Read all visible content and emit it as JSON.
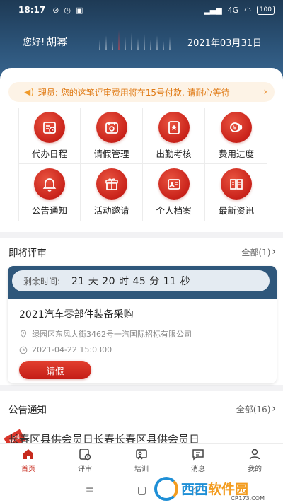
{
  "status_bar": {
    "time": "18:17",
    "battery": "100",
    "signal": "4G"
  },
  "header": {
    "greeting": "您好!",
    "user_name": "胡幂",
    "date": "2021年03月31日"
  },
  "notice": {
    "text": "理员: 您的这笔评审费用将在15号付款, 请耐心等待"
  },
  "quick_menu": [
    {
      "label": "代办日程",
      "icon": "schedule-icon"
    },
    {
      "label": "请假管理",
      "icon": "leave-calendar-icon"
    },
    {
      "label": "出勤考核",
      "icon": "attendance-icon"
    },
    {
      "label": "费用进度",
      "icon": "coins-icon"
    },
    {
      "label": "公告通知",
      "icon": "bell-icon"
    },
    {
      "label": "活动邀请",
      "icon": "gift-icon"
    },
    {
      "label": "个人档案",
      "icon": "profile-card-icon"
    },
    {
      "label": "最新资讯",
      "icon": "news-icon"
    }
  ],
  "upcoming": {
    "title": "即将评审",
    "more": "全部(1)",
    "card": {
      "countdown_label": "剩余时间:",
      "countdown_value": "21 天 20 时 45 分 11 秒",
      "title": "2021汽车零部件装备采购",
      "location": "绿园区东风大街3462号一汽国际招标有限公司",
      "datetime": "2021-04-22 15:0300",
      "button": "请假"
    }
  },
  "announcements": {
    "title": "公告通知",
    "more": "全部(16)",
    "first_item": "长春区县供会员日长春长春区县供会员日"
  },
  "tabs": [
    {
      "label": "首页",
      "icon": "home-icon",
      "active": true
    },
    {
      "label": "评审",
      "icon": "review-icon",
      "active": false
    },
    {
      "label": "培训",
      "icon": "training-icon",
      "active": false
    },
    {
      "label": "消息",
      "icon": "message-icon",
      "active": false
    },
    {
      "label": "我的",
      "icon": "user-icon",
      "active": false
    }
  ],
  "watermark": {
    "brand_a": "西西",
    "brand_b": "软件园",
    "url": "CR173.COM"
  },
  "colors": {
    "primary_red": "#c9221a",
    "header_blue": "#2c5479",
    "notice_orange": "#e07b16"
  }
}
